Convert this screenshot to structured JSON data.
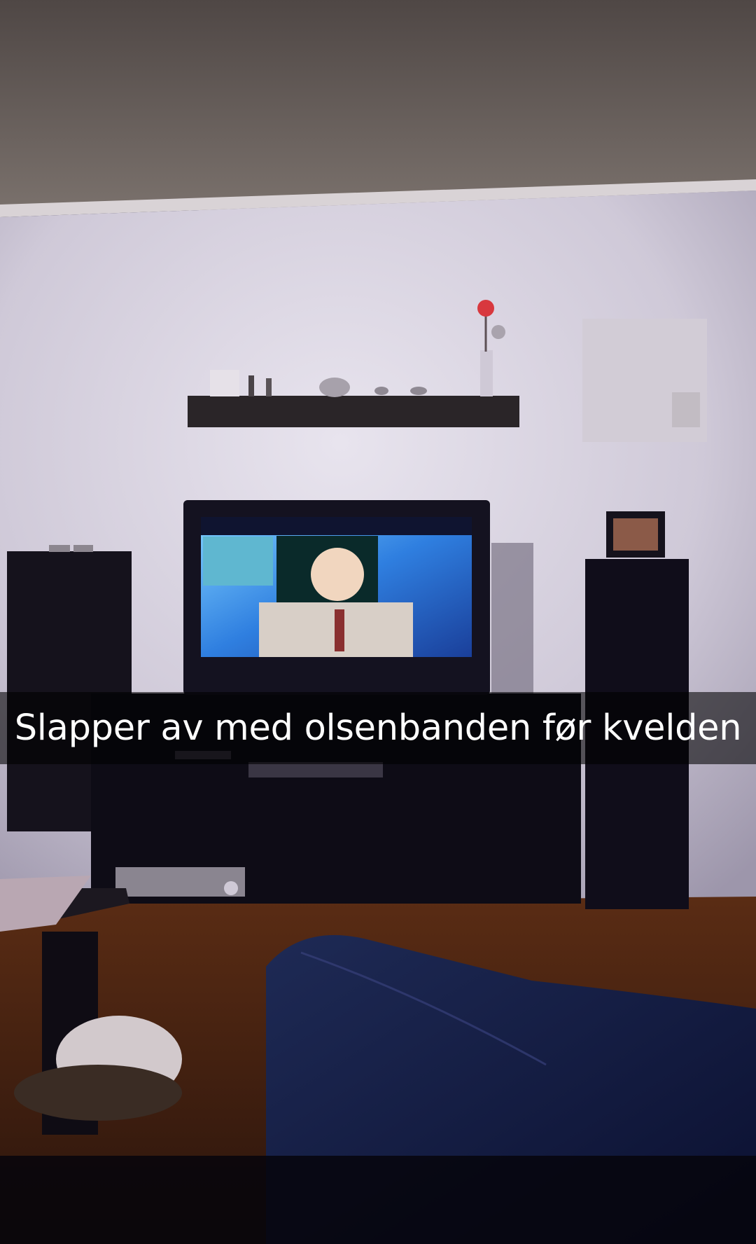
{
  "snap": {
    "caption": "Slapper av med olsenbanden før kvelden"
  },
  "colors": {
    "caption_bar": "#000000",
    "caption_text": "#ffffff",
    "wall": "#d8d3e0",
    "ceiling": "#6b625e",
    "floor": "#4a2412",
    "tv_screen": "#3aa0ff"
  }
}
